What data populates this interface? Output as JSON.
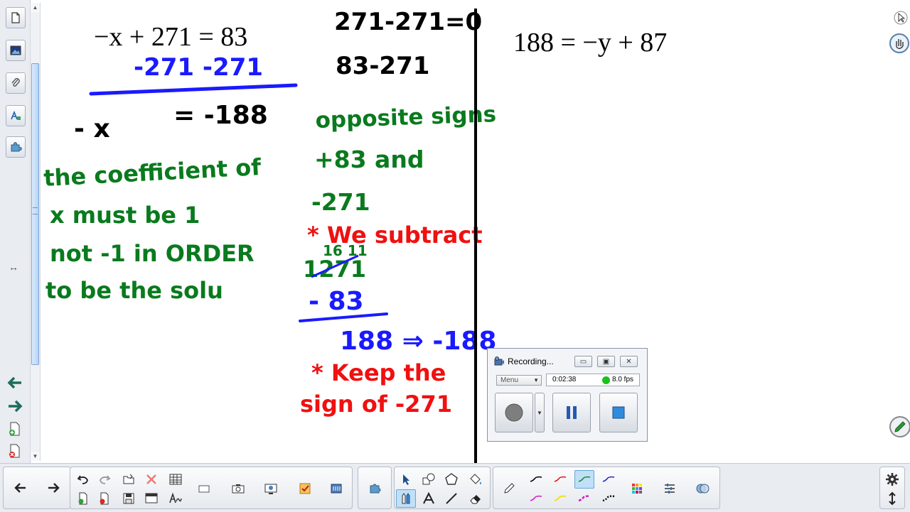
{
  "recording": {
    "title": "Recording...",
    "menu_label": "Menu",
    "time": "0:02:38",
    "fps": "8.0 fps"
  },
  "board": {
    "eq1_printed": "−x + 271 = 83",
    "eq1_step": "-271   -271",
    "eq1_lhs": "- x",
    "eq1_rhs": "= -188",
    "note_line1": "the coefficient of",
    "note_line2": "x  must be  1",
    "note_line3": "not  -1  in ORDER",
    "note_line4": "to be the solu",
    "mid_line1": "271-271=0",
    "mid_line2": "83-271",
    "mid_line3": "opposite signs",
    "mid_line4": "+83  and",
    "mid_line5": "-271",
    "rule1": "* We subtract",
    "work_top": "1271",
    "work_borrow": "16 11",
    "work_sub": "- 83",
    "work_result": "188 ⇒ -188",
    "rule2_line1": "* Keep the",
    "rule2_line2": "sign of -271",
    "eq2_printed": "188 = −y + 87"
  },
  "colors": {
    "blue_ink": "#1a1aff",
    "green_ink": "#0a7a1e",
    "red_ink": "#f01010",
    "black_ink": "#000000"
  }
}
